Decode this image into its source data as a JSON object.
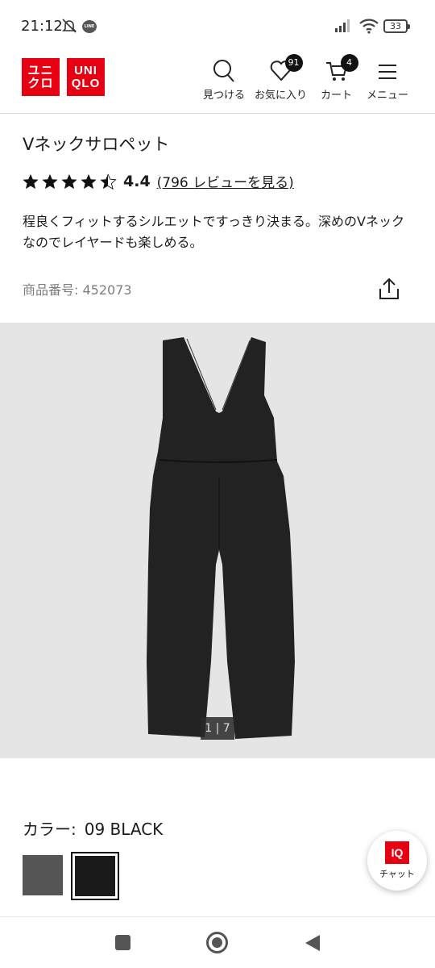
{
  "status_bar": {
    "time": "21:12",
    "line_label": "LINE",
    "battery": "33"
  },
  "header": {
    "logo_top": "ユニ",
    "logo_bottom": "クロ",
    "logo_top2": "UNI",
    "logo_bottom2": "QLO",
    "nav": [
      {
        "label": "見つける",
        "icon": "search-icon"
      },
      {
        "label": "お気に入り",
        "icon": "heart-icon",
        "badge": "91"
      },
      {
        "label": "カート",
        "icon": "cart-icon",
        "badge": "4"
      },
      {
        "label": "メニュー",
        "icon": "hamburger-icon"
      }
    ]
  },
  "product": {
    "title": "Vネックサロペット",
    "rating": 4.4,
    "rating_label": "4.4",
    "reviews_link": "(796 レビューを見る)",
    "description": "程良くフィットするシルエットですっきり決まる。深めのVネックなのでレイヤードも楽しめる。",
    "number_label": "商品番号:",
    "number_value": "452073"
  },
  "gallery": {
    "counter": "1 | 7"
  },
  "color": {
    "label": "カラー:",
    "selected": "09 BLACK",
    "swatches": [
      {
        "name": "gray",
        "color": "#555555"
      },
      {
        "name": "black",
        "color": "#1a1a1a",
        "selected": true
      }
    ]
  },
  "chat": {
    "logo": "IQ",
    "label": "チャット"
  },
  "colors": {
    "brand_red": "#e60012",
    "photo_bg": "#e5e5e5"
  }
}
